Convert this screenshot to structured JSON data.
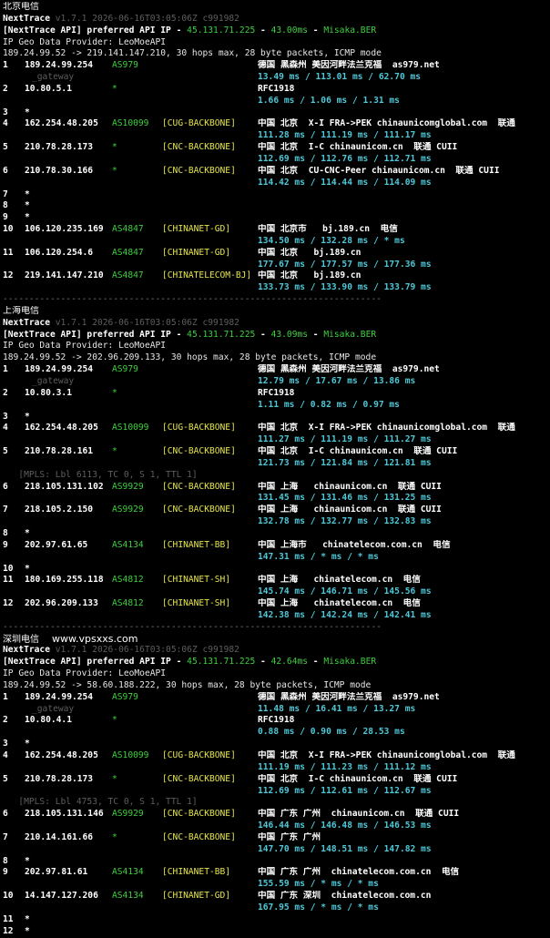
{
  "sections": [
    {
      "region": "北京电信",
      "watermark": "",
      "nt_name": "NextTrace",
      "nt_version": "v1.7.1 2026-06-16T03:05:06Z c991982",
      "api_prefix": "[NextTrace API] preferred API IP - ",
      "api_ip": "45.131.71.225",
      "api_sep1": " - ",
      "api_ms": "43.00ms",
      "api_sep2": " - ",
      "api_node": "Misaka.BER",
      "geo_provider": "IP Geo Data Provider: LeoMoeAPI",
      "route": "189.24.99.52 -> 219.141.147.210, 30 hops max, 28 byte packets, ICMP mode",
      "hops": [
        {
          "n": "1",
          "ip": "189.24.99.254",
          "as": "AS979",
          "tag": "",
          "geo": "德国 黑森州 美因河畔法兰克福  as979.net",
          "sub": "_gateway",
          "ms": "13.49 ms / 113.01 ms / 62.70 ms"
        },
        {
          "n": "2",
          "ip": "10.80.5.1",
          "as": "*",
          "tag": "",
          "geo": "RFC1918",
          "ms": "1.66 ms / 1.06 ms / 1.31 ms"
        },
        {
          "n": "3",
          "ip": "*",
          "as": "",
          "tag": "",
          "geo": ""
        },
        {
          "n": "4",
          "ip": "162.254.48.205",
          "as": "AS10099",
          "tag": "[CUG-BACKBONE]",
          "geo": "中国 北京  X-I FRA->PEK chinaunicomglobal.com  联通",
          "ms": "111.28 ms / 111.19 ms / 111.17 ms"
        },
        {
          "n": "5",
          "ip": "210.78.28.173",
          "as": "*",
          "tag": "[CNC-BACKBONE]",
          "geo": "中国 北京  I-C chinaunicom.cn  联通 CUII",
          "ms": "112.69 ms / 112.76 ms / 112.71 ms"
        },
        {
          "n": "6",
          "ip": "210.78.30.166",
          "as": "*",
          "tag": "[CNC-BACKBONE]",
          "geo": "中国 北京  CU-CNC-Peer chinaunicom.cn  联通 CUII",
          "ms": "114.42 ms / 114.44 ms / 114.09 ms"
        },
        {
          "n": "7",
          "ip": "*",
          "as": "",
          "tag": "",
          "geo": ""
        },
        {
          "n": "8",
          "ip": "*",
          "as": "",
          "tag": "",
          "geo": ""
        },
        {
          "n": "9",
          "ip": "*",
          "as": "",
          "tag": "",
          "geo": ""
        },
        {
          "n": "10",
          "ip": "106.120.235.169",
          "as": "AS4847",
          "tag": "[CHINANET-GD]",
          "geo": "中国 北京市   bj.189.cn  电信",
          "ms": "134.50 ms / 132.28 ms / * ms"
        },
        {
          "n": "11",
          "ip": "106.120.254.6",
          "as": "AS4847",
          "tag": "[CHINANET-GD]",
          "geo": "中国 北京   bj.189.cn",
          "ms": "177.67 ms / 177.57 ms / 177.36 ms"
        },
        {
          "n": "12",
          "ip": "219.141.147.210",
          "as": "AS4847",
          "tag": "[CHINATELECOM-BJ]",
          "geo": "中国 北京   bj.189.cn",
          "ms": "133.73 ms / 133.90 ms / 133.79 ms"
        }
      ],
      "rule": "------------------------------------------------------------------------"
    },
    {
      "region": "上海电信",
      "watermark": "",
      "nt_name": "NextTrace",
      "nt_version": "v1.7.1 2026-06-16T03:05:06Z c991982",
      "api_prefix": "[NextTrace API] preferred API IP - ",
      "api_ip": "45.131.71.225",
      "api_sep1": " - ",
      "api_ms": "43.09ms",
      "api_sep2": " - ",
      "api_node": "Misaka.BER",
      "geo_provider": "IP Geo Data Provider: LeoMoeAPI",
      "route": "189.24.99.52 -> 202.96.209.133, 30 hops max, 28 byte packets, ICMP mode",
      "hops": [
        {
          "n": "1",
          "ip": "189.24.99.254",
          "as": "AS979",
          "tag": "",
          "geo": "德国 黑森州 美因河畔法兰克福  as979.net",
          "sub": "_gateway",
          "ms": "12.79 ms / 17.67 ms / 13.86 ms"
        },
        {
          "n": "2",
          "ip": "10.80.3.1",
          "as": "*",
          "tag": "",
          "geo": "RFC1918",
          "ms": "1.11 ms / 0.82 ms / 0.97 ms"
        },
        {
          "n": "3",
          "ip": "*",
          "as": "",
          "tag": "",
          "geo": ""
        },
        {
          "n": "4",
          "ip": "162.254.48.205",
          "as": "AS10099",
          "tag": "[CUG-BACKBONE]",
          "geo": "中国 北京  X-I FRA->PEK chinaunicomglobal.com  联通",
          "ms": "111.27 ms / 111.19 ms / 111.27 ms"
        },
        {
          "n": "5",
          "ip": "210.78.28.161",
          "as": "*",
          "tag": "[CNC-BACKBONE]",
          "geo": "中国 北京  I-C chinaunicom.cn  联通 CUII",
          "ms": "121.73 ms / 121.84 ms / 121.81 ms"
        },
        {
          "n": "6",
          "ip": "218.105.131.102",
          "as": "AS9929",
          "tag": "[CNC-BACKBONE]",
          "geo": "中国 上海   chinaunicom.cn  联通 CUII",
          "ms": "131.45 ms / 131.46 ms / 131.25 ms",
          "mpls": "[MPLS: Lbl 6113, TC 0, S 1, TTL 1]"
        },
        {
          "n": "7",
          "ip": "218.105.2.150",
          "as": "AS9929",
          "tag": "[CNC-BACKBONE]",
          "geo": "中国 上海   chinaunicom.cn  联通 CUII",
          "ms": "132.78 ms / 132.77 ms / 132.83 ms"
        },
        {
          "n": "8",
          "ip": "*",
          "as": "",
          "tag": "",
          "geo": ""
        },
        {
          "n": "9",
          "ip": "202.97.61.65",
          "as": "AS4134",
          "tag": "[CHINANET-BB]",
          "geo": "中国 上海市   chinatelecom.com.cn  电信",
          "ms": "147.31 ms / * ms / * ms"
        },
        {
          "n": "10",
          "ip": "*",
          "as": "",
          "tag": "",
          "geo": ""
        },
        {
          "n": "11",
          "ip": "180.169.255.118",
          "as": "AS4812",
          "tag": "[CHINANET-SH]",
          "geo": "中国 上海   chinatelecom.cn  电信",
          "ms": "145.74 ms / 146.71 ms / 145.56 ms"
        },
        {
          "n": "12",
          "ip": "202.96.209.133",
          "as": "AS4812",
          "tag": "[CHINANET-SH]",
          "geo": "中国 上海   chinatelecom.cn  电信",
          "ms": "142.38 ms / 142.24 ms / 142.41 ms"
        }
      ],
      "rule": "------------------------------------------------------------------------"
    },
    {
      "region": "深圳电信",
      "watermark": "www.vpsxxs.com",
      "nt_name": "NextTrace",
      "nt_version": "v1.7.1 2026-06-16T03:05:06Z c991982",
      "api_prefix": "[NextTrace API] preferred API IP - ",
      "api_ip": "45.131.71.225",
      "api_sep1": " - ",
      "api_ms": "42.64ms",
      "api_sep2": " - ",
      "api_node": "Misaka.BER",
      "geo_provider": "IP Geo Data Provider: LeoMoeAPI",
      "route": "189.24.99.52 -> 58.60.188.222, 30 hops max, 28 byte packets, ICMP mode",
      "hops": [
        {
          "n": "1",
          "ip": "189.24.99.254",
          "as": "AS979",
          "tag": "",
          "geo": "德国 黑森州 美因河畔法兰克福  as979.net",
          "sub": "_gateway",
          "ms": "11.48 ms / 16.41 ms / 13.27 ms"
        },
        {
          "n": "2",
          "ip": "10.80.4.1",
          "as": "*",
          "tag": "",
          "geo": "RFC1918",
          "ms": "0.88 ms / 0.90 ms / 28.53 ms"
        },
        {
          "n": "3",
          "ip": "*",
          "as": "",
          "tag": "",
          "geo": ""
        },
        {
          "n": "4",
          "ip": "162.254.48.205",
          "as": "AS10099",
          "tag": "[CUG-BACKBONE]",
          "geo": "中国 北京  X-I FRA->PEK chinaunicomglobal.com  联通",
          "ms": "111.19 ms / 111.23 ms / 111.12 ms"
        },
        {
          "n": "5",
          "ip": "210.78.28.173",
          "as": "*",
          "tag": "[CNC-BACKBONE]",
          "geo": "中国 北京  I-C chinaunicom.cn  联通 CUII",
          "ms": "112.69 ms / 112.61 ms / 112.67 ms"
        },
        {
          "n": "6",
          "ip": "218.105.131.146",
          "as": "AS9929",
          "tag": "[CNC-BACKBONE]",
          "geo": "中国 广东 广州  chinaunicom.cn  联通 CUII",
          "ms": "146.44 ms / 146.48 ms / 146.53 ms",
          "mpls": "[MPLS: Lbl 4753, TC 0, S 1, TTL 1]"
        },
        {
          "n": "7",
          "ip": "210.14.161.66",
          "as": "*",
          "tag": "[CNC-BACKBONE]",
          "geo": "中国 广东 广州",
          "ms": "147.70 ms / 148.51 ms / 147.82 ms"
        },
        {
          "n": "8",
          "ip": "*",
          "as": "",
          "tag": "",
          "geo": ""
        },
        {
          "n": "9",
          "ip": "202.97.81.61",
          "as": "AS4134",
          "tag": "[CHINANET-BB]",
          "geo": "中国 广东 广州  chinatelecom.com.cn  电信",
          "ms": "155.59 ms / * ms / * ms"
        },
        {
          "n": "10",
          "ip": "14.147.127.206",
          "as": "AS4134",
          "tag": "[CHINANET-GD]",
          "geo": "中国 广东 深圳  chinatelecom.com.cn",
          "ms": "167.95 ms / * ms / * ms"
        },
        {
          "n": "11",
          "ip": "*",
          "as": "",
          "tag": "",
          "geo": ""
        },
        {
          "n": "12",
          "ip": "*",
          "as": "",
          "tag": "",
          "geo": ""
        }
      ],
      "rule": ""
    }
  ]
}
